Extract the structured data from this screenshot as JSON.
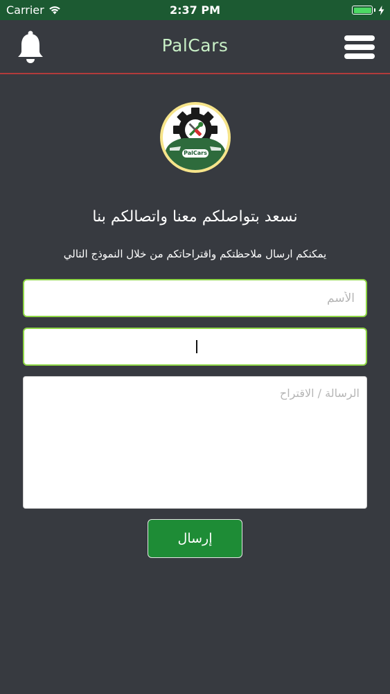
{
  "status_bar": {
    "carrier": "Carrier",
    "time": "2:37 PM"
  },
  "nav": {
    "title": "PalCars",
    "left_icon": "bell-icon",
    "right_icon": "menu-icon"
  },
  "logo": {
    "text": "PalCars",
    "icon": "gear-wrench-screwdriver-car-logo"
  },
  "content": {
    "heading": "نسعد بتواصلكم معنا واتصالكم بنا",
    "subheading": "يمكنكم ارسال ملاحظتكم واقتراحاتكم من خلال النموذج التالي"
  },
  "form": {
    "name_placeholder": "الأسم",
    "name_value": "",
    "email_placeholder": "",
    "email_value": "",
    "message_placeholder": "الرسالة / الاقتراح",
    "message_value": "",
    "submit_label": "إرسال"
  },
  "colors": {
    "status_bar_bg": "#1c5a32",
    "background": "#373a40",
    "accent_line": "#b23b3b",
    "title_color": "#c8efc6",
    "field_border": "#8ed645",
    "submit_bg": "#1e8c36",
    "battery": "#4cd964"
  }
}
